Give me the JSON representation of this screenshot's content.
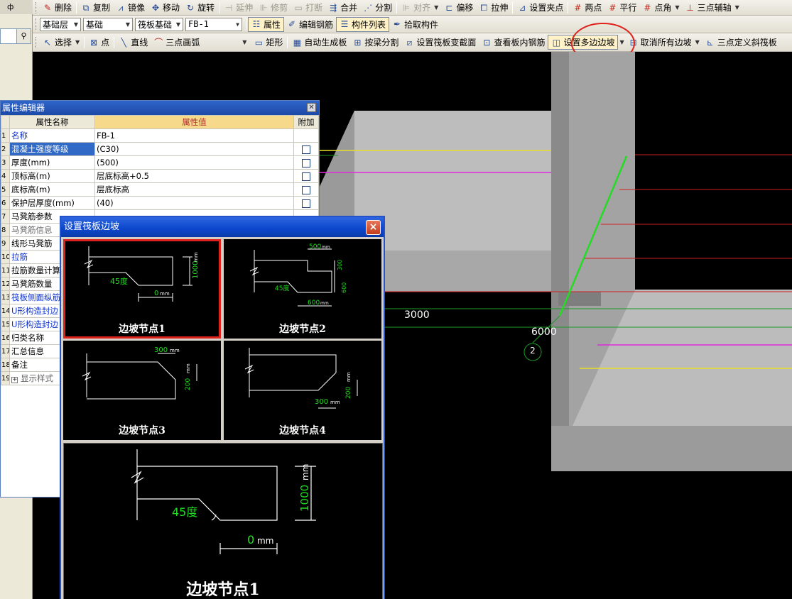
{
  "toolbar1": {
    "pin": "ф",
    "items": [
      {
        "label": "删除",
        "icon": "delete-icon"
      },
      {
        "label": "复制",
        "icon": "copy-icon"
      },
      {
        "label": "镜像",
        "icon": "mirror-icon"
      },
      {
        "label": "移动",
        "icon": "move-icon"
      },
      {
        "label": "旋转",
        "icon": "rotate-icon"
      },
      {
        "label": "延伸",
        "icon": "extend-icon"
      },
      {
        "label": "修剪",
        "icon": "trim-icon"
      },
      {
        "label": "打断",
        "icon": "break-icon"
      },
      {
        "label": "合并",
        "icon": "merge-icon"
      },
      {
        "label": "分割",
        "icon": "split-icon"
      },
      {
        "label": "对齐",
        "icon": "align-icon"
      },
      {
        "label": "偏移",
        "icon": "offset-icon"
      },
      {
        "label": "拉伸",
        "icon": "stretch-icon"
      },
      {
        "label": "设置夹点",
        "icon": "grip-point-icon"
      },
      {
        "label": "两点",
        "icon": "two-point-icon"
      },
      {
        "label": "平行",
        "icon": "parallel-icon"
      },
      {
        "label": "点角",
        "icon": "point-angle-icon"
      },
      {
        "label": "三点辅轴",
        "icon": "three-point-axis-icon"
      }
    ]
  },
  "toolbar2": {
    "floor": "基础层",
    "category": "基础",
    "type": "筏板基础",
    "member": "FB-1",
    "properties": "属性",
    "edit_rebar": "编辑钢筋",
    "member_list": "构件列表",
    "pick_member": "拾取构件"
  },
  "toolbar3": {
    "select": "选择",
    "point": "点",
    "line": "直线",
    "arc": "三点画弧",
    "rect": "矩形",
    "auto_slab": "自动生成板",
    "split_by_beam": "按梁分割",
    "set_section": "设置筏板变截面",
    "view_rebar": "查看板内钢筋",
    "set_multi_slope": "设置多边边坡",
    "cancel_slopes": "取消所有边坡",
    "three_point_slope": "三点定义斜筏板"
  },
  "canvas": {
    "dim1": "3000",
    "dim2": "6000",
    "axis_label": "2"
  },
  "property_editor": {
    "title": "属性编辑器",
    "col_name": "属性名称",
    "col_value": "属性值",
    "col_extra": "附加",
    "rows": [
      {
        "num": "1",
        "name": "名称",
        "value": "FB-1",
        "style": "blue",
        "check": false
      },
      {
        "num": "2",
        "name": "混凝土强度等级",
        "value": "(C30)",
        "style": "sel",
        "check": true
      },
      {
        "num": "3",
        "name": "厚度(mm)",
        "value": "(500)",
        "style": "",
        "check": true
      },
      {
        "num": "4",
        "name": "顶标高(m)",
        "value": "层底标高+0.5",
        "style": "",
        "check": true
      },
      {
        "num": "5",
        "name": "底标高(m)",
        "value": "层底标高",
        "style": "",
        "check": true
      },
      {
        "num": "6",
        "name": "保护层厚度(mm)",
        "value": "(40)",
        "style": "",
        "check": true
      },
      {
        "num": "7",
        "name": "马凳筋参数",
        "value": "",
        "style": "",
        "check": false
      },
      {
        "num": "8",
        "name": "马凳筋信息",
        "value": "",
        "style": "gray",
        "check": false
      },
      {
        "num": "9",
        "name": "线形马凳筋",
        "value": "",
        "style": "",
        "check": false
      },
      {
        "num": "10",
        "name": "拉筋",
        "value": "",
        "style": "blue",
        "check": false
      },
      {
        "num": "11",
        "name": "拉筋数量计算",
        "value": "",
        "style": "",
        "check": false
      },
      {
        "num": "12",
        "name": "马凳筋数量",
        "value": "",
        "style": "",
        "check": false
      },
      {
        "num": "13",
        "name": "筏板侧面纵筋",
        "value": "",
        "style": "blue",
        "check": false
      },
      {
        "num": "14",
        "name": "U形构造封边",
        "value": "",
        "style": "blue",
        "check": false
      },
      {
        "num": "15",
        "name": "U形构造封边",
        "value": "",
        "style": "blue",
        "check": false
      },
      {
        "num": "16",
        "name": "归类名称",
        "value": "",
        "style": "",
        "check": false
      },
      {
        "num": "17",
        "name": "汇总信息",
        "value": "",
        "style": "",
        "check": false
      },
      {
        "num": "18",
        "name": "备注",
        "value": "",
        "style": "",
        "check": false
      },
      {
        "num": "19",
        "name": "显示样式",
        "value": "",
        "style": "expand",
        "check": false
      }
    ]
  },
  "dialog": {
    "title": "设置筏板边坡",
    "close": "×",
    "options": [
      {
        "label": "边坡节点1",
        "angle": "45度",
        "height": "1000",
        "width": "0",
        "unit": "mm"
      },
      {
        "label": "边坡节点2",
        "angle": "45度",
        "top": "500",
        "height": "300",
        "height2": "600",
        "width": "600",
        "unit": "mm"
      },
      {
        "label": "边坡节点3",
        "width": "300",
        "height": "200",
        "unit": "mm"
      },
      {
        "label": "边坡节点4",
        "width": "300",
        "height": "200",
        "unit": "mm"
      }
    ],
    "preview": {
      "label": "边坡节点1",
      "angle": "45度",
      "height": "1000",
      "width": "0",
      "unit": "mm"
    }
  },
  "colors": {
    "highlight": "#e0221c",
    "dim_green": "#22dd22",
    "title_blue": "#0b46cc"
  }
}
